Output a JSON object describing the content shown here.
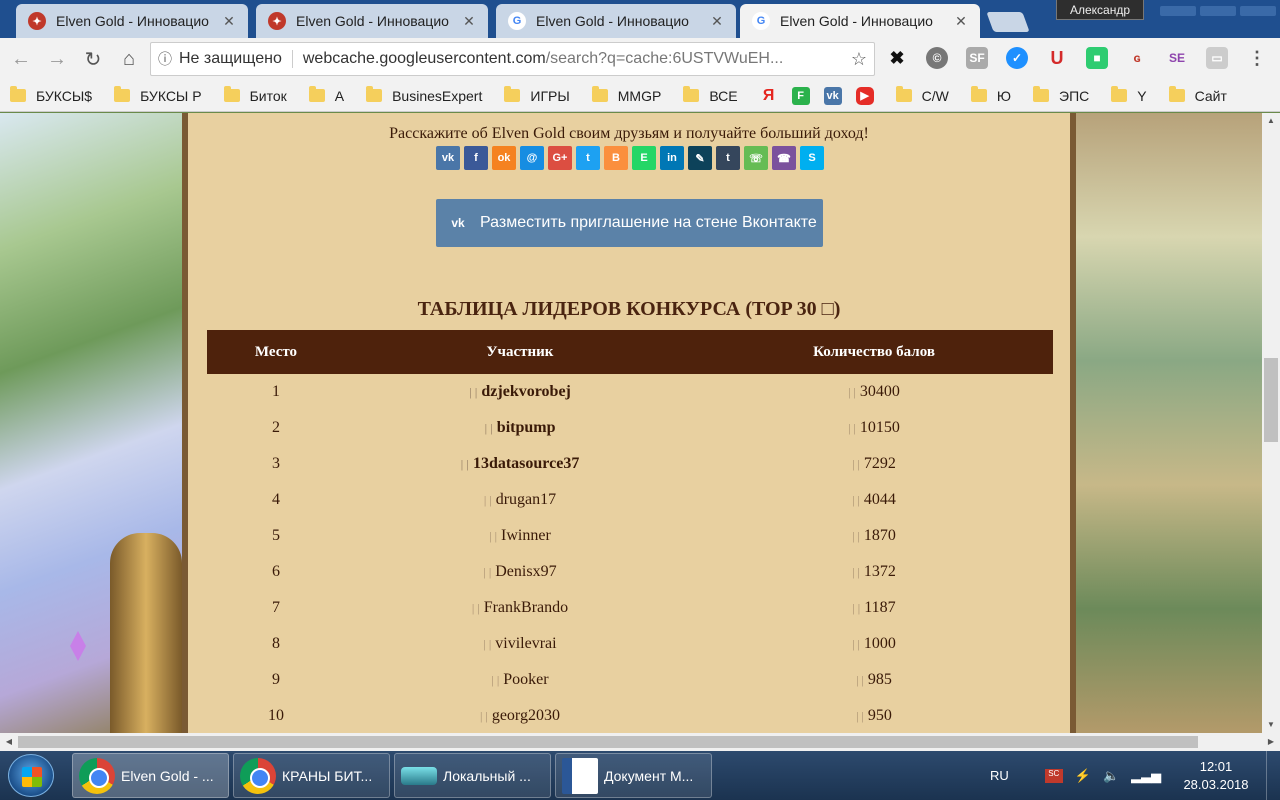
{
  "browser": {
    "tabs": [
      {
        "title": "Elven Gold - Инновацио",
        "active": false
      },
      {
        "title": "Elven Gold - Инновацио",
        "active": false
      },
      {
        "title": "Elven Gold - Инновацио",
        "active": false
      },
      {
        "title": "Elven Gold - Инновацио",
        "active": true
      }
    ],
    "user": "Александр",
    "security_label": "Не защищено",
    "url_host": "webcache.googleusercontent.com",
    "url_rest": "/search?q=cache:6USTVWuEH...",
    "bookmarks": [
      {
        "label": "БУКСЫ$",
        "icon": "folder-icon"
      },
      {
        "label": "БУКСЫ Р",
        "icon": "folder-icon"
      },
      {
        "label": "Биток",
        "icon": "folder-icon"
      },
      {
        "label": "А",
        "icon": "folder-icon"
      },
      {
        "label": "BusinesExpert",
        "icon": "folder-icon"
      },
      {
        "label": "ИГРЫ",
        "icon": "folder-icon"
      },
      {
        "label": "MMGP",
        "icon": "folder-icon"
      },
      {
        "label": "ВСЕ",
        "icon": "folder-icon"
      },
      {
        "label": "",
        "icon": "yandex-icon"
      },
      {
        "label": "",
        "icon": "feedly-icon"
      },
      {
        "label": "",
        "icon": "vk-icon"
      },
      {
        "label": "",
        "icon": "youtube-icon"
      },
      {
        "label": "C/W",
        "icon": "folder-icon"
      },
      {
        "label": "Ю",
        "icon": "folder-icon"
      },
      {
        "label": "ЭПС",
        "icon": "folder-icon"
      },
      {
        "label": "Y",
        "icon": "folder-icon"
      },
      {
        "label": "Сайт",
        "icon": "folder-icon"
      }
    ]
  },
  "page": {
    "share_text": "Расскажите об Elven Gold своим друзьям и получайте больший доход!",
    "share_icons": [
      "vk-icon",
      "facebook-icon",
      "odnoklassniki-icon",
      "moimir-icon",
      "googleplus-icon",
      "twitter-icon",
      "blogger-icon",
      "evernote-icon",
      "linkedin-icon",
      "livejournal-icon",
      "tumblr-icon",
      "whatsapp-icon",
      "viber-icon",
      "skype-icon"
    ],
    "vk_button_label": "Разместить приглашение на стене Вконтакте",
    "table_title": "ТАБЛИЦА ЛИДЕРОВ КОНКУРСА (TOP 30 □)",
    "table": {
      "headers": [
        "Место",
        "Участник",
        "Количество балов"
      ],
      "rows": [
        {
          "place": "1",
          "user": "dzjekvorobej",
          "points": "30400",
          "bold": true
        },
        {
          "place": "2",
          "user": "bitpump",
          "points": "10150",
          "bold": true
        },
        {
          "place": "3",
          "user": "13datasource37",
          "points": "7292",
          "bold": true
        },
        {
          "place": "4",
          "user": "drugan17",
          "points": "4044",
          "bold": false
        },
        {
          "place": "5",
          "user": "Iwinner",
          "points": "1870",
          "bold": false
        },
        {
          "place": "6",
          "user": "Denisx97",
          "points": "1372",
          "bold": false
        },
        {
          "place": "7",
          "user": "FrankBrando",
          "points": "1187",
          "bold": false
        },
        {
          "place": "8",
          "user": "vivilevrai",
          "points": "1000",
          "bold": false
        },
        {
          "place": "9",
          "user": "Pooker",
          "points": "985",
          "bold": false
        },
        {
          "place": "10",
          "user": "georg2030",
          "points": "950",
          "bold": false
        }
      ]
    }
  },
  "taskbar": {
    "items": [
      {
        "label": "Elven Gold - ...",
        "icon": "chrome-icon",
        "active": true
      },
      {
        "label": "КРАНЫ БИТ...",
        "icon": "chrome-icon",
        "active": false
      },
      {
        "label": "Локальный ...",
        "icon": "drive-icon",
        "active": false
      },
      {
        "label": "Документ M...",
        "icon": "word-icon",
        "active": false
      }
    ],
    "language": "RU",
    "time": "12:01",
    "date": "28.03.2018"
  }
}
